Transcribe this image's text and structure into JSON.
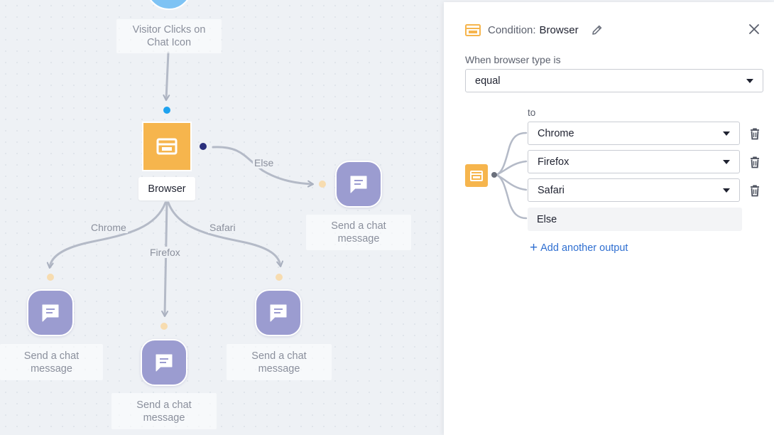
{
  "canvas": {
    "start_node": {
      "label": "Visitor Clicks on Chat Icon"
    },
    "condition_node": {
      "label": "Browser"
    },
    "edge_labels": {
      "else": "Else",
      "chrome": "Chrome",
      "firefox": "Firefox",
      "safari": "Safari"
    },
    "message_nodes": [
      {
        "label": "Send a chat message"
      },
      {
        "label": "Send a chat message"
      },
      {
        "label": "Send a chat message"
      },
      {
        "label": "Send a chat message"
      }
    ]
  },
  "panel": {
    "header": {
      "prefix": "Condition:",
      "name": "Browser"
    },
    "when_label": "When browser type is",
    "operator": {
      "selected": "equal"
    },
    "to_label": "to",
    "outputs": [
      {
        "selected": "Chrome"
      },
      {
        "selected": "Firefox"
      },
      {
        "selected": "Safari"
      }
    ],
    "else_label": "Else",
    "add_output_label": "Add another output",
    "icons": [
      "condition-icon",
      "pencil-icon",
      "close-icon",
      "trash-icon",
      "chat-icon",
      "plus-icon"
    ]
  },
  "colors": {
    "condition": "#f6b54d",
    "message_node": "#9b9cd0",
    "start_node": "#7ec3f4",
    "connector": "#b4bac7",
    "link": "#2f6fd1"
  }
}
